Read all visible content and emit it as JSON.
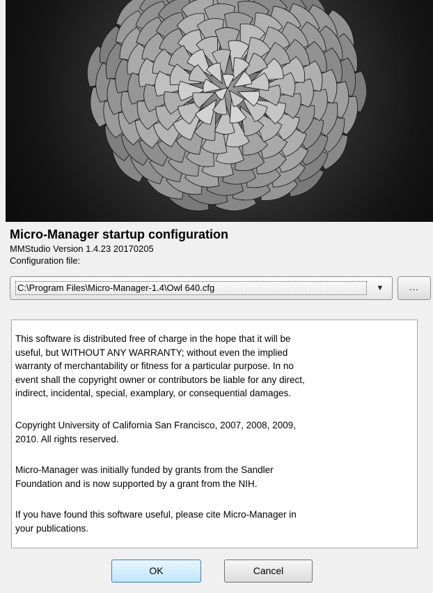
{
  "splash": {
    "image": "succulent-spiral-photo"
  },
  "header": {
    "title": "Micro-Manager startup configuration",
    "version": "MMStudio Version 1.4.23 20170205",
    "config_label": "Configuration file:"
  },
  "config": {
    "selected": "C:\\Program Files\\Micro-Manager-1.4\\Owl 640.cfg",
    "arrow_icon": "▼",
    "browse_label": "..."
  },
  "license": {
    "paragraphs": [
      "This software is distributed free of charge in the hope that it will be\nuseful, but WITHOUT ANY WARRANTY; without even the implied\nwarranty of merchantability or fitness for a particular purpose. In no\nevent shall the copyright owner or contributors be liable for any direct,\nindirect, incidental, special, examplary, or consequential damages.",
      "Copyright University of California San Francisco, 2007, 2008, 2009,\n2010. All rights reserved.",
      "Micro-Manager was initially funded by grants from the Sandler\nFoundation and is now supported by a grant from the NIH.",
      "If you have found this software useful, please cite Micro-Manager in\nyour publications."
    ]
  },
  "buttons": {
    "ok": "OK",
    "cancel": "Cancel"
  }
}
